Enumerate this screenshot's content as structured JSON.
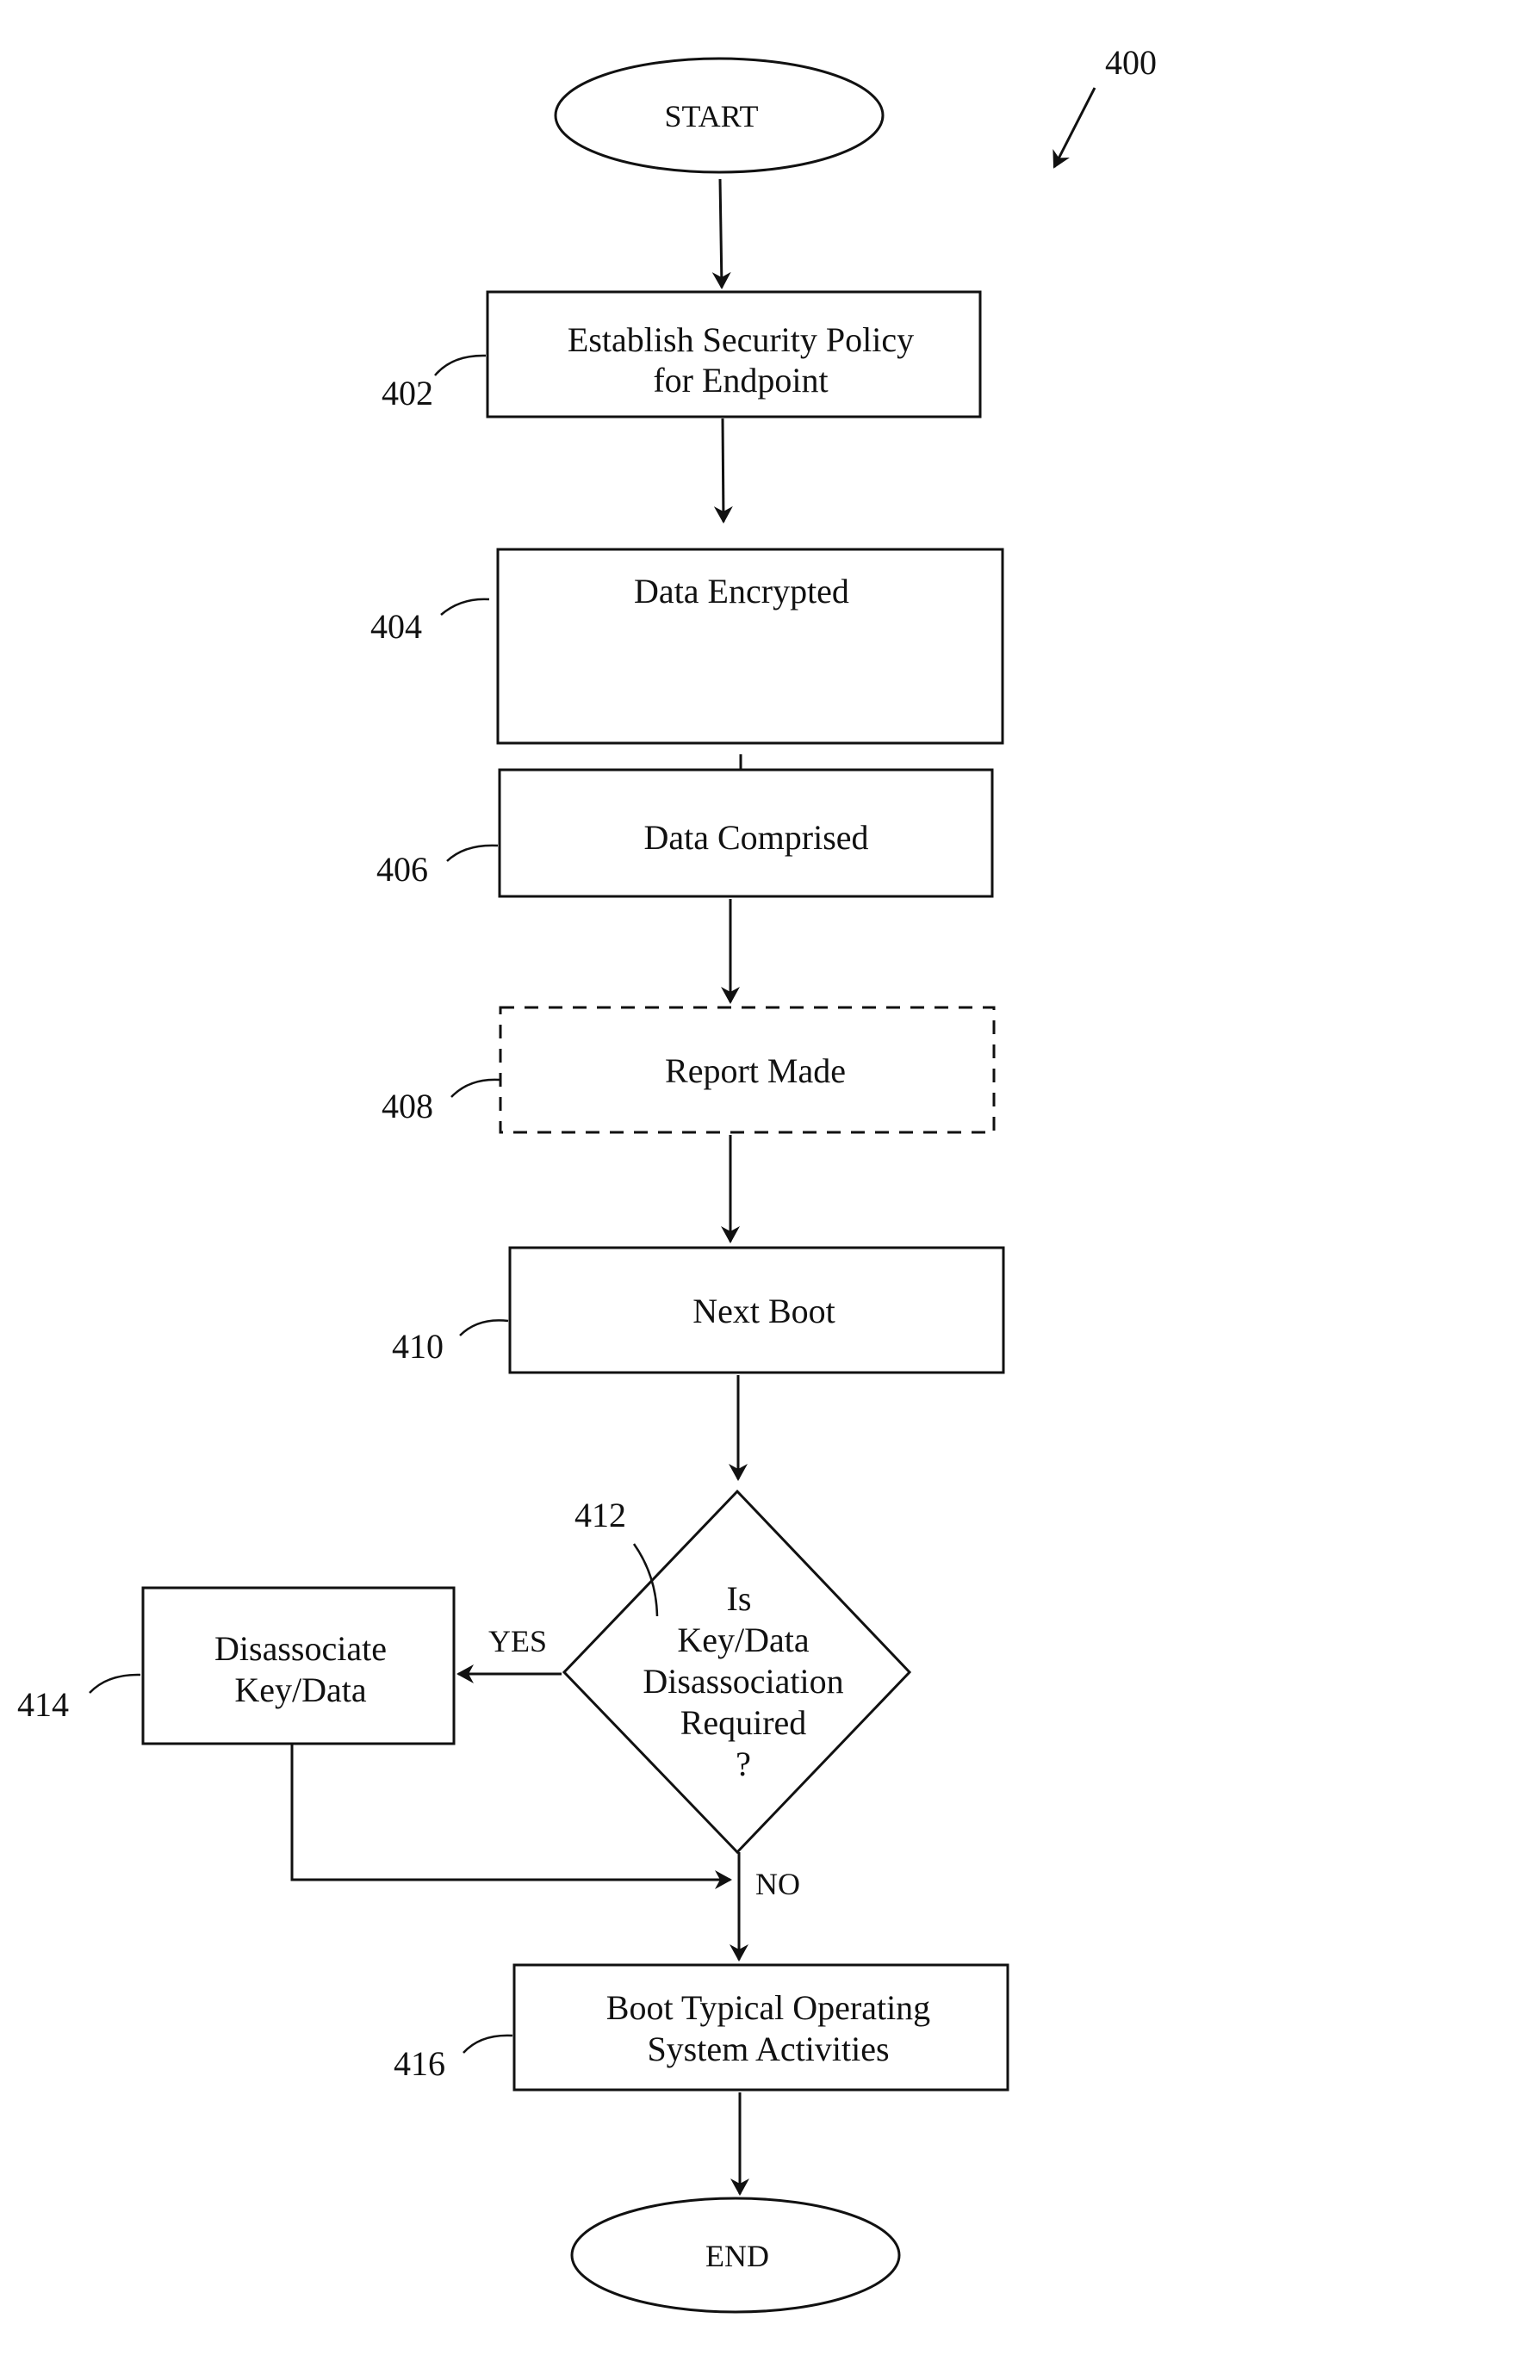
{
  "figure": {
    "reference": "400"
  },
  "nodes": {
    "start": {
      "label": "START"
    },
    "n402": {
      "ref": "402",
      "lines": [
        "Establish Security Policy",
        "for Endpoint"
      ]
    },
    "n404": {
      "ref": "404",
      "lines": [
        "Data Encrypted"
      ]
    },
    "n406": {
      "ref": "406",
      "lines": [
        "Data Comprised"
      ]
    },
    "n408": {
      "ref": "408",
      "lines": [
        "Report Made"
      ],
      "style": "dashed"
    },
    "n410": {
      "ref": "410",
      "lines": [
        "Next Boot"
      ]
    },
    "n412": {
      "ref": "412",
      "lines": [
        "Is",
        "Key/Data",
        "Disassociation",
        "Required",
        "?"
      ]
    },
    "n414": {
      "ref": "414",
      "lines": [
        "Disassociate",
        "Key/Data"
      ]
    },
    "n416": {
      "ref": "416",
      "lines": [
        "Boot Typical Operating",
        "System Activities"
      ]
    },
    "end": {
      "label": "END"
    }
  },
  "edges": {
    "yes_label": "YES",
    "no_label": "NO"
  }
}
